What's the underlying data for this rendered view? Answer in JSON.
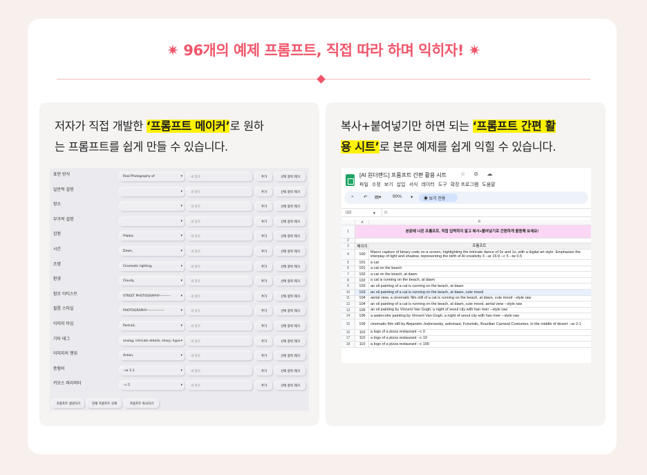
{
  "headline": {
    "star": "✷",
    "text": "96개의 예제 프롬프트, 직접 따라 하며 익히자!"
  },
  "left": {
    "caption_pre": "저자가 직접 개발한 ",
    "caption_hl": "‘프롬프트 메이커’",
    "caption_post": "로 원하",
    "caption_line2": "는 프롬프트를 쉽게 만들 수 있습니다.",
    "maker": {
      "input_placeholder": "새 항목",
      "add_label": "추가",
      "delete_label": "선택 항목 제거",
      "rows": [
        {
          "label": "표현 방식",
          "value": "Real Photography of"
        },
        {
          "label": "일반적 설명",
          "value": ""
        },
        {
          "label": "장소",
          "value": ""
        },
        {
          "label": "부가적 설명",
          "value": ""
        },
        {
          "label": "감정",
          "value": "Happy,"
        },
        {
          "label": "시간",
          "value": "Dawn,"
        },
        {
          "label": "조명",
          "value": "Cinematic lighting,"
        },
        {
          "label": "환경",
          "value": "Cloudy,"
        },
        {
          "label": "참조 아티스트",
          "value": "STREET PHOTOGRAPHY----------"
        },
        {
          "label": "필름 스타일",
          "value": "PHOTOGRAPHY----------------"
        },
        {
          "label": "이미지 타입",
          "value": "Portrait,"
        },
        {
          "label": "기타 태그",
          "value": "analog, intricate details, sharp, hype"
        },
        {
          "label": "이미지의 행위",
          "value": "Action,"
        },
        {
          "label": "종횡비",
          "value": "--ar 1:1"
        },
        {
          "label": "카오스 파라미터",
          "value": "--c 5"
        }
      ],
      "bottom_buttons": [
        "프롬프트 생성하기",
        "현재 프롬프트 삭제",
        "프롬프트 복사하기"
      ]
    }
  },
  "right": {
    "caption_pre": "복사+붙여넣기만 하면 되는 ",
    "caption_hl1": "‘프롬프트 간편 활",
    "caption_hl2": "용 시트’",
    "caption_post": "로 본문 예제를 쉽게 익힐 수 있습니다.",
    "sheet": {
      "title": "[AI 원더랜드] 프롬프트 간편 활용 시트",
      "title_icons": "☆ ⊘ ☁",
      "menu": [
        "파일",
        "수정",
        "보기",
        "삽입",
        "서식",
        "데이터",
        "도구",
        "확장 프로그램",
        "도움말"
      ],
      "toolbar_items": [
        "⌕",
        "↶",
        "▤▾",
        "90%",
        "▾"
      ],
      "view_mode": "보기 전용",
      "cell_ref": "I10",
      "fx": "fx",
      "col_a": "A",
      "col_b": "B",
      "banner": "본문에 나온 프롬프트, 직접 입력하지 말고 복사+붙여넣기로 간편하게 활용해 보세요!",
      "header_page": "페이지",
      "header_prompt": "프롬프트",
      "rows": [
        {
          "n": "4",
          "page": "100",
          "prompt": "Macro capture of binary code on a screen, highlighting the intricate dance of 0s and 1s, with a digital art style. Emphasize the interplay of light and shadow, representing the birth of AI creativity 3 --ar 16:9 --c 5 --iw 0.5"
        },
        {
          "n": "5",
          "page": "101",
          "prompt": "a cat"
        },
        {
          "n": "6",
          "page": "101",
          "prompt": "a cat on the beach"
        },
        {
          "n": "7",
          "page": "102",
          "prompt": "a cat on the beach, at dawn"
        },
        {
          "n": "8",
          "page": "102",
          "prompt": "a cat is running on the beach, at dawn"
        },
        {
          "n": "9",
          "page": "103",
          "prompt": "an oil painting of a cat is running on the beach, at dawn"
        },
        {
          "n": "10",
          "page": "103",
          "prompt": "an oil painting of a cat is running on the beach, at dawn, cute mood"
        },
        {
          "n": "11",
          "page": "104",
          "prompt": "aerial view, a cinematic film still of a cat is running on the beach, at dawn, cute mood --style raw"
        },
        {
          "n": "12",
          "page": "104",
          "prompt": "an oil painting of a cat is running on the beach, at dawn, cute mood, aerial view --style raw"
        },
        {
          "n": "13",
          "page": "105",
          "prompt": "an oil painting by Vincent Van Gogh, a night of seoul city with han river --style raw"
        },
        {
          "n": "14",
          "page": "106",
          "prompt": "a watercolor painting by Vincent Van Gogh, a night of seoul city with han river --style raw"
        },
        {
          "n": "15",
          "page": "109",
          "prompt": "cinematic film still by Alejandro Jodorowsky, astronaut, Futuristic, Brazilian Carnival Costumes, in the middle of desert --ar 2:1"
        },
        {
          "n": "16",
          "page": "110",
          "prompt": "a logo of a pizza restaurant --c 0"
        },
        {
          "n": "17",
          "page": "110",
          "prompt": "a logo of a pizza restaurant --c 10"
        },
        {
          "n": "18",
          "page": "110",
          "prompt": "a logo of a pizza restaurant --c 100"
        }
      ]
    }
  }
}
